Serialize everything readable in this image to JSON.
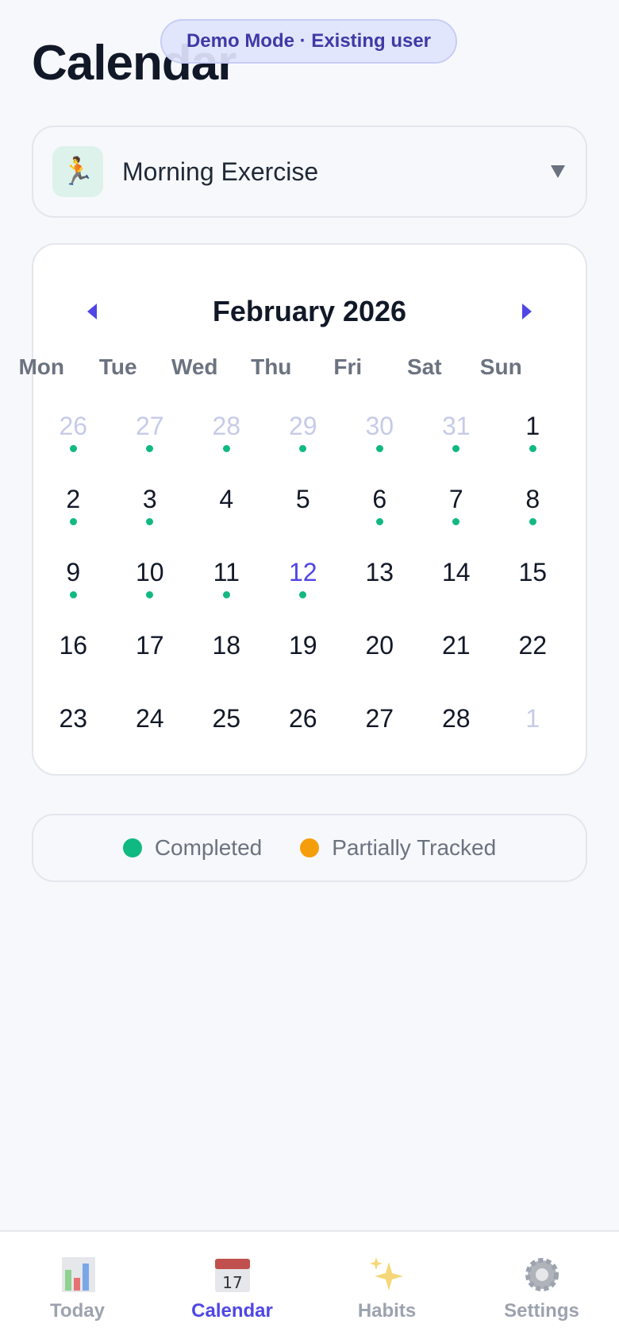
{
  "page": {
    "title": "Calendar"
  },
  "demo_banner": "Demo Mode · Existing user",
  "habit_selector": {
    "emoji": "🏃",
    "name": "Morning Exercise"
  },
  "calendar": {
    "month_label": "February 2026",
    "weekdays": [
      "Mon",
      "Tue",
      "Wed",
      "Thu",
      "Fri",
      "Sat",
      "Sun"
    ],
    "days": [
      {
        "label": "26",
        "other": true,
        "completed": true
      },
      {
        "label": "27",
        "other": true,
        "completed": true
      },
      {
        "label": "28",
        "other": true,
        "completed": true
      },
      {
        "label": "29",
        "other": true,
        "completed": true
      },
      {
        "label": "30",
        "other": true,
        "completed": true
      },
      {
        "label": "31",
        "other": true,
        "completed": true
      },
      {
        "label": "1",
        "completed": true
      },
      {
        "label": "2",
        "completed": true
      },
      {
        "label": "3",
        "completed": true
      },
      {
        "label": "4"
      },
      {
        "label": "5"
      },
      {
        "label": "6",
        "completed": true
      },
      {
        "label": "7",
        "completed": true
      },
      {
        "label": "8",
        "completed": true
      },
      {
        "label": "9",
        "completed": true
      },
      {
        "label": "10",
        "completed": true
      },
      {
        "label": "11",
        "completed": true
      },
      {
        "label": "12",
        "today": true,
        "completed": true
      },
      {
        "label": "13"
      },
      {
        "label": "14"
      },
      {
        "label": "15"
      },
      {
        "label": "16"
      },
      {
        "label": "17"
      },
      {
        "label": "18"
      },
      {
        "label": "19"
      },
      {
        "label": "20"
      },
      {
        "label": "21"
      },
      {
        "label": "22"
      },
      {
        "label": "23"
      },
      {
        "label": "24"
      },
      {
        "label": "25"
      },
      {
        "label": "26"
      },
      {
        "label": "27"
      },
      {
        "label": "28"
      },
      {
        "label": "1",
        "other": true
      }
    ]
  },
  "legend": {
    "completed": {
      "label": "Completed",
      "color": "#10b981"
    },
    "partial": {
      "label": "Partially Tracked",
      "color": "#f59e0b"
    }
  },
  "tabs": [
    {
      "label": "Today",
      "icon": "bar-chart-icon",
      "active": false
    },
    {
      "label": "Calendar",
      "icon": "calendar-icon",
      "active": true
    },
    {
      "label": "Habits",
      "icon": "sparkles-icon",
      "active": false
    },
    {
      "label": "Settings",
      "icon": "gear-icon",
      "active": false
    }
  ],
  "colors": {
    "accent": "#4f46e5",
    "completed": "#10b981",
    "partial": "#f59e0b"
  }
}
